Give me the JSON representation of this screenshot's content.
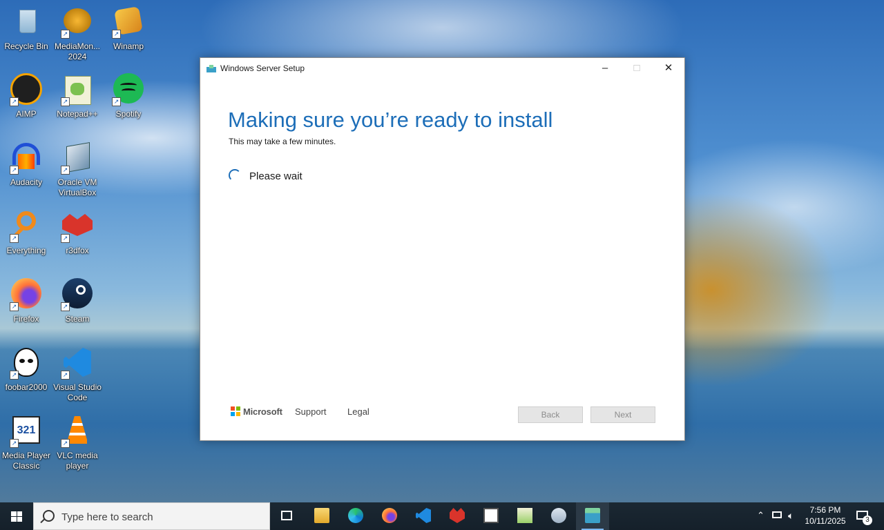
{
  "desktop": {
    "icons": [
      {
        "label": "Recycle Bin",
        "icon": "recycle-bin-icon"
      },
      {
        "label": "MediaMon...\n2024",
        "icon": "mediamonkey-icon"
      },
      {
        "label": "Winamp",
        "icon": "winamp-icon"
      },
      {
        "label": "AIMP",
        "icon": "aimp-icon"
      },
      {
        "label": "Notepad++",
        "icon": "notepad-plus-plus-icon"
      },
      {
        "label": "Spotify",
        "icon": "spotify-icon"
      },
      {
        "label": "Audacity",
        "icon": "audacity-icon"
      },
      {
        "label": "Oracle VM\nVirtualBox",
        "icon": "virtualbox-icon"
      },
      {
        "label": "Everything",
        "icon": "everything-icon"
      },
      {
        "label": "r3dfox",
        "icon": "r3dfox-icon"
      },
      {
        "label": "Firefox",
        "icon": "firefox-icon"
      },
      {
        "label": "Steam",
        "icon": "steam-icon"
      },
      {
        "label": "foobar2000",
        "icon": "foobar2000-icon"
      },
      {
        "label": "Visual Studio\nCode",
        "icon": "vscode-icon"
      },
      {
        "label": "Media Player\nClassic",
        "icon": "media-player-classic-icon"
      },
      {
        "label": "VLC media\nplayer",
        "icon": "vlc-icon"
      }
    ]
  },
  "window": {
    "title": "Windows Server Setup",
    "heading": "Making sure you’re ready to install",
    "subheading": "This may take a few minutes.",
    "status": "Please wait",
    "footer": {
      "brand": "Microsoft",
      "support": "Support",
      "legal": "Legal",
      "back": "Back",
      "next": "Next"
    }
  },
  "taskbar": {
    "search_placeholder": "Type here to search",
    "time": "7:56 PM",
    "date": "10/11/2025",
    "notification_count": "3"
  },
  "colors": {
    "accent": "#1d6eb8",
    "taskbar": "#1b2833"
  }
}
